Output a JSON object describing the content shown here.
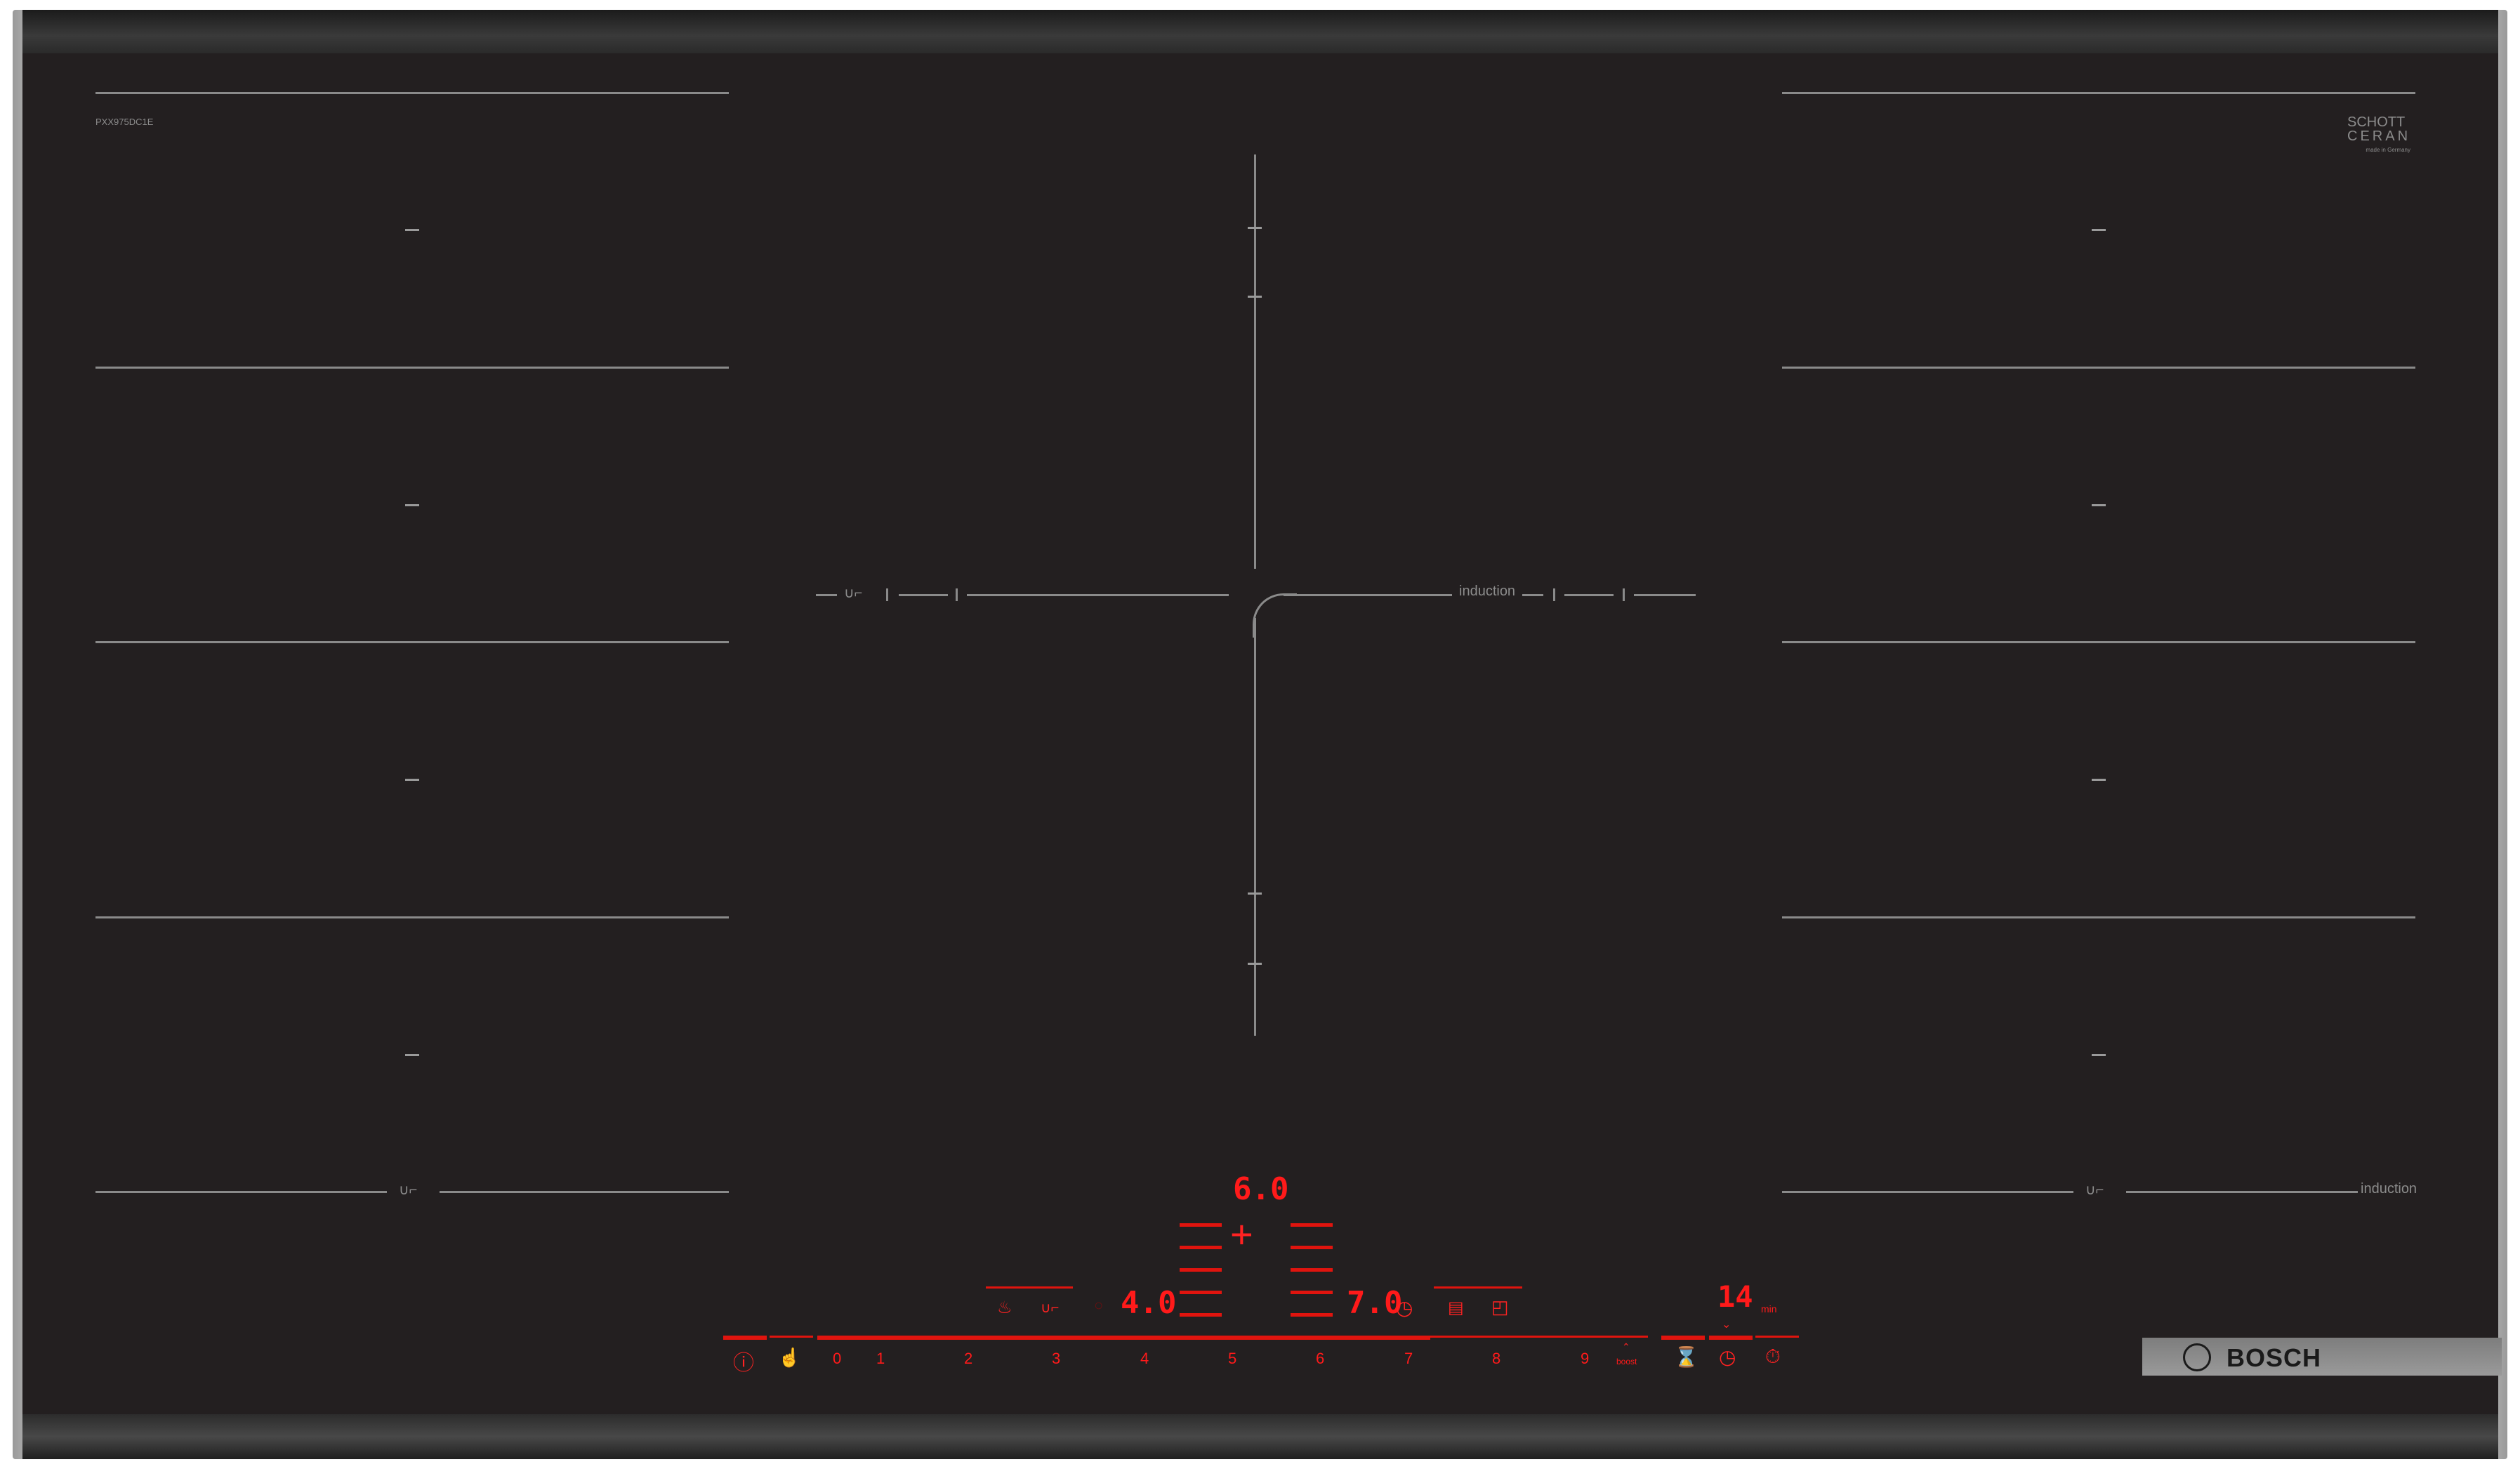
{
  "model": "PXX975DC1E",
  "ceran": {
    "brand_line1": "SCHOTT",
    "brand_line2": "CERAN",
    "sub": "made in Germany"
  },
  "zone_labels": {
    "induction_center": "induction",
    "induction_right": "induction"
  },
  "display": {
    "center_top": "6.0",
    "left_level": "4.0",
    "right_level": "7.0",
    "timer_value": "14",
    "timer_unit": "min"
  },
  "slider_scale": [
    "0",
    "1",
    "2",
    "3",
    "4",
    "5",
    "6",
    "7",
    "8",
    "9"
  ],
  "boost_label": "boost",
  "brand": "BOSCH",
  "colors": {
    "glass": "#231f20",
    "led": "#ff1a1a",
    "line": "#8a8a8a"
  },
  "icons": [
    "info-icon",
    "childlock-icon",
    "frying-sensor-icon",
    "move-function-icon",
    "timer-icon",
    "stopwatch-icon",
    "clock-icon",
    "recipe-icon",
    "pot-sensor-icon",
    "bosch-logo-icon"
  ]
}
